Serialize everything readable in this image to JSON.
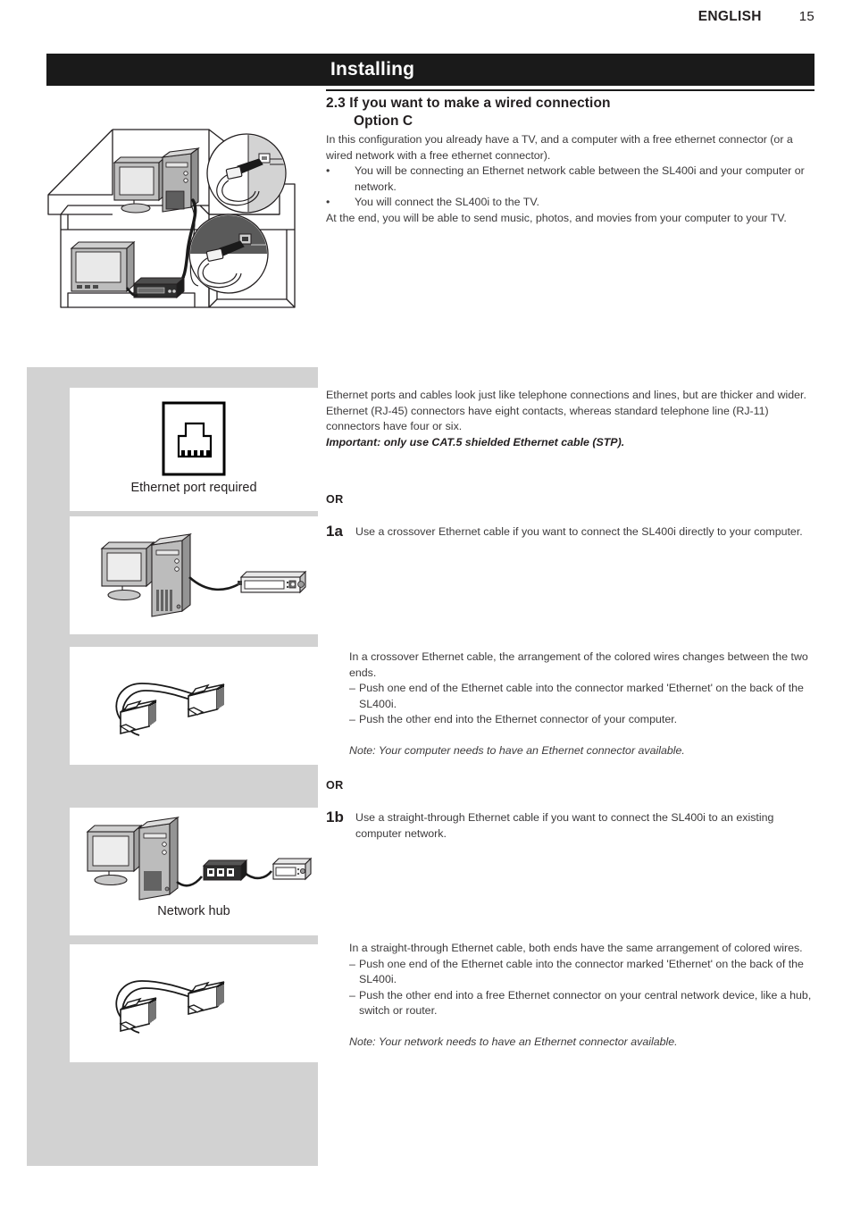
{
  "header": {
    "language": "ENGLISH",
    "page_number": "15"
  },
  "title_bar": {
    "title": "Installing"
  },
  "section": {
    "number": "2.3",
    "heading_line1": "If you want to make a wired connection",
    "heading_line2": "Option C",
    "intro_p1": "In this configuration you already have a TV, and a computer with a free ethernet connector (or a wired network with a free ethernet connector).",
    "bullets": [
      "You will be connecting an Ethernet network cable between the SL400i and your computer or network.",
      "You will connect the SL400i to the TV."
    ],
    "bullet_marker": "•",
    "closing": "At the end, you will be able to send music, photos, and movies from your computer to your TV."
  },
  "ethernet_info": {
    "paragraph": "Ethernet ports and cables look just like telephone connections and lines, but are thicker and wider. Ethernet (RJ-45) connectors have eight contacts, whereas standard telephone line (RJ-11) connectors have four or six.",
    "important": "Important: only use CAT.5 shielded Ethernet cable (STP)."
  },
  "or_label": "OR",
  "step_1a": {
    "number": "1a",
    "text": "Use a crossover Ethernet cable if you want to connect the SL400i directly to your computer."
  },
  "crossover_detail": {
    "intro": "In a crossover Ethernet cable, the arrangement of the colored wires changes between the two ends.",
    "dash_marker": "–",
    "dashes": [
      "Push one end of the Ethernet cable into the connector marked 'Ethernet' on the back of the SL400i.",
      "Push the other end into the Ethernet connector of your computer."
    ],
    "note": "Note: Your computer needs to have an Ethernet connector available."
  },
  "step_1b": {
    "number": "1b",
    "text": "Use a straight-through Ethernet cable if you want to connect the SL400i to an existing computer network."
  },
  "straight_detail": {
    "intro": "In a straight-through Ethernet cable, both ends have the same arrangement of colored wires.",
    "dash_marker": "–",
    "dashes": [
      "Push one end of the Ethernet cable into the connector marked 'Ethernet' on the back of the SL400i.",
      "Push the other end into a free Ethernet connector on your central network device, like a hub, switch or router."
    ],
    "note": "Note: Your network needs to have an Ethernet connector available."
  },
  "figures": {
    "ethernet_port": {
      "caption": "Ethernet port required",
      "icon": "rj45-port-icon"
    },
    "pc_direct": {
      "caption": "",
      "icon": "computer-to-sl400i-icon"
    },
    "crossover_cable": {
      "caption": "",
      "icon": "ethernet-cable-icon"
    },
    "network_hub": {
      "caption": "Network hub",
      "icon": "computer-hub-sl400i-icon"
    },
    "straight_cable": {
      "caption": "",
      "icon": "ethernet-cable-icon"
    },
    "house": {
      "icon": "house-cutaway-diagram"
    }
  },
  "colors": {
    "header_bar": "#1a1a1a",
    "gray_panel": "#d2d2d2",
    "card": "#ffffff",
    "body_text": "#3c3a3b"
  }
}
